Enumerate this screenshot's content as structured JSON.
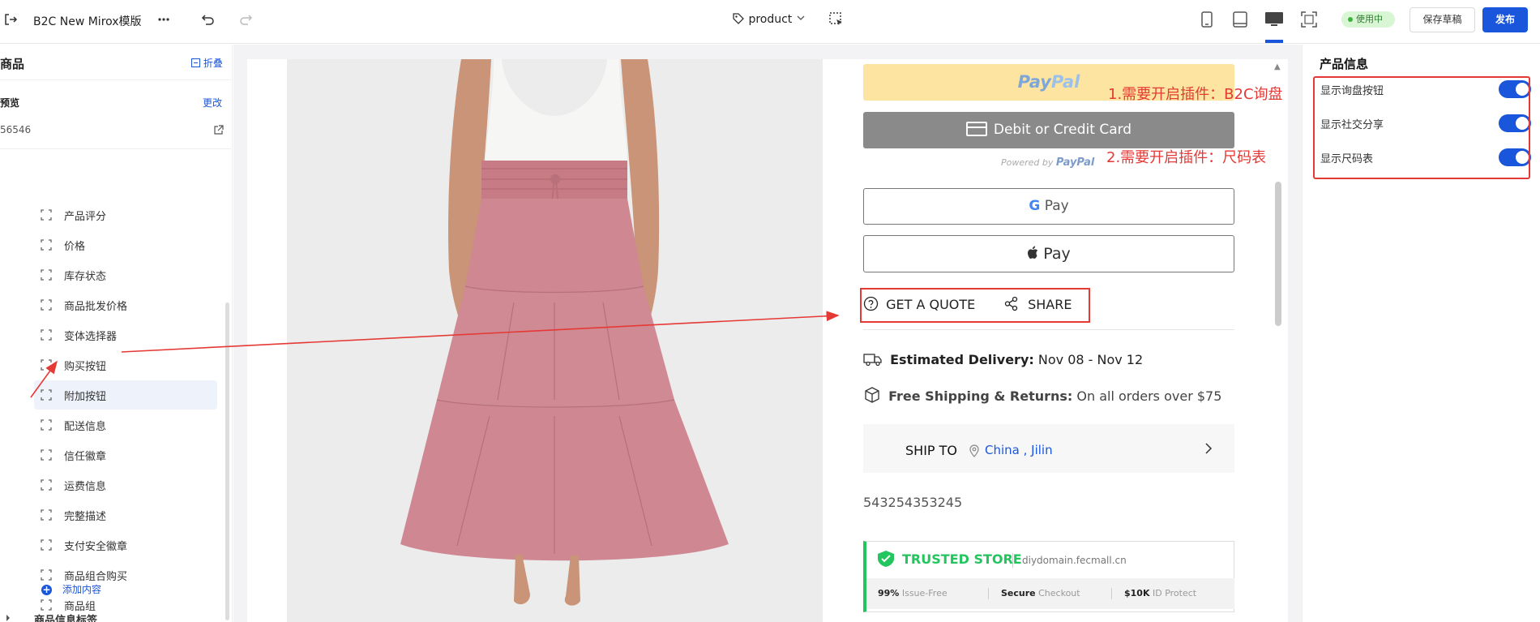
{
  "topbar": {
    "title": "B2C New Mirox模版",
    "page_selector": "product",
    "status_badge": "使用中",
    "save_draft": "保存草稿",
    "publish": "发布"
  },
  "left_panel": {
    "section_title": "商品",
    "collapse_label": "折叠",
    "preview_label": "预览",
    "change_label": "更改",
    "product_id": "56546",
    "items": [
      "产品评分",
      "价格",
      "库存状态",
      "商品批发价格",
      "变体选择器",
      "购买按钮",
      "附加按钮",
      "配送信息",
      "信任徽章",
      "运费信息",
      "完整描述",
      "支付安全徽章",
      "商品组合购买",
      "商品组"
    ],
    "active_item": "附加按钮",
    "add_content": "添加内容",
    "next_section": "商品信息标签"
  },
  "preview": {
    "paypal_button": {
      "pay": "Pay",
      "pal": "Pal"
    },
    "card_button": "Debit or Credit Card",
    "powered_by": "Powered by",
    "powered_brand": "PayPal",
    "gpay": "Pay",
    "apple_pay": "Pay",
    "get_quote": "GET A QUOTE",
    "share": "SHARE",
    "delivery_label": "Estimated Delivery:",
    "delivery_value": "Nov 08 - Nov 12",
    "shipping_label": "Free Shipping & Returns:",
    "shipping_value": "On all orders over $75",
    "ship_to_label": "SHIP TO",
    "ship_to_value": "China , Jilin",
    "sku_code": "543254353245",
    "trusted": {
      "title": "TRUSTED STORE",
      "domain": "diydomain.fecmall.cn",
      "stats": [
        {
          "bold": "99%",
          "text": "Issue-Free"
        },
        {
          "bold": "Secure",
          "text": "Checkout"
        },
        {
          "bold": "$10K",
          "text": "ID Protect"
        }
      ]
    }
  },
  "annotations": {
    "note1": "1.需要开启插件：B2C询盘",
    "note2": "2.需要开启插件：尺码表"
  },
  "right_panel": {
    "title": "产品信息",
    "toggles": [
      {
        "label": "显示询盘按钮",
        "on": true
      },
      {
        "label": "显示社交分享",
        "on": true
      },
      {
        "label": "显示尺码表",
        "on": true
      }
    ]
  },
  "colors": {
    "accent": "#1a56db",
    "annotation_red": "#e53935",
    "paypal_yellow": "#fde4a0",
    "card_gray": "#8a8a8a",
    "trusted_green": "#22c55e"
  }
}
